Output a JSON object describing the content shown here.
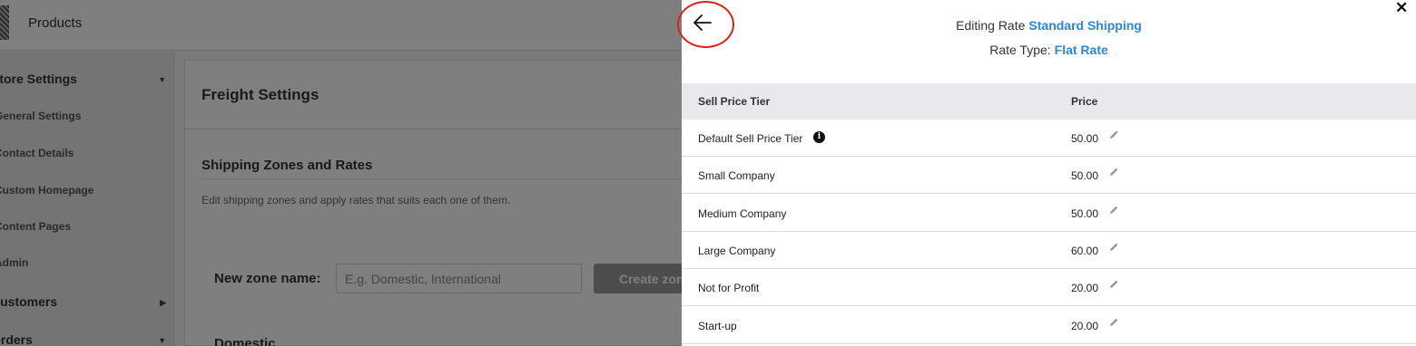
{
  "app": {
    "top_title": "Products"
  },
  "sidebar": {
    "sections": [
      {
        "label": "Store Settings",
        "expanded": true,
        "items": [
          "General Settings",
          "Contact Details",
          "Custom Homepage",
          "Content Pages",
          "Admin"
        ]
      },
      {
        "label": "Customers",
        "expanded": false
      },
      {
        "label": "Orders",
        "expanded": true
      }
    ]
  },
  "main": {
    "title": "Freight Settings",
    "section_title": "Shipping Zones and Rates",
    "description": "Edit shipping zones and apply rates that suits each one of them.",
    "new_zone_label": "New zone name:",
    "new_zone_placeholder": "E.g. Domestic, International",
    "new_zone_value": "",
    "create_button": "Create zone",
    "zone_name": "Domestic"
  },
  "panel": {
    "editing_label": "Editing Rate",
    "rate_name": "Standard Shipping",
    "rate_type_label": "Rate Type:",
    "rate_type": "Flat Rate",
    "columns": [
      "Sell Price Tier",
      "Price"
    ],
    "rows": [
      {
        "tier": "Default Sell Price Tier",
        "price": "50.00",
        "has_info": true
      },
      {
        "tier": "Small Company",
        "price": "50.00"
      },
      {
        "tier": "Medium Company",
        "price": "50.00"
      },
      {
        "tier": "Large Company",
        "price": "60.00"
      },
      {
        "tier": "Not for Profit",
        "price": "20.00"
      },
      {
        "tier": "Start-up",
        "price": "20.00"
      }
    ],
    "accent_color": "#2b86dd",
    "highlight_color": "#e0201b"
  }
}
